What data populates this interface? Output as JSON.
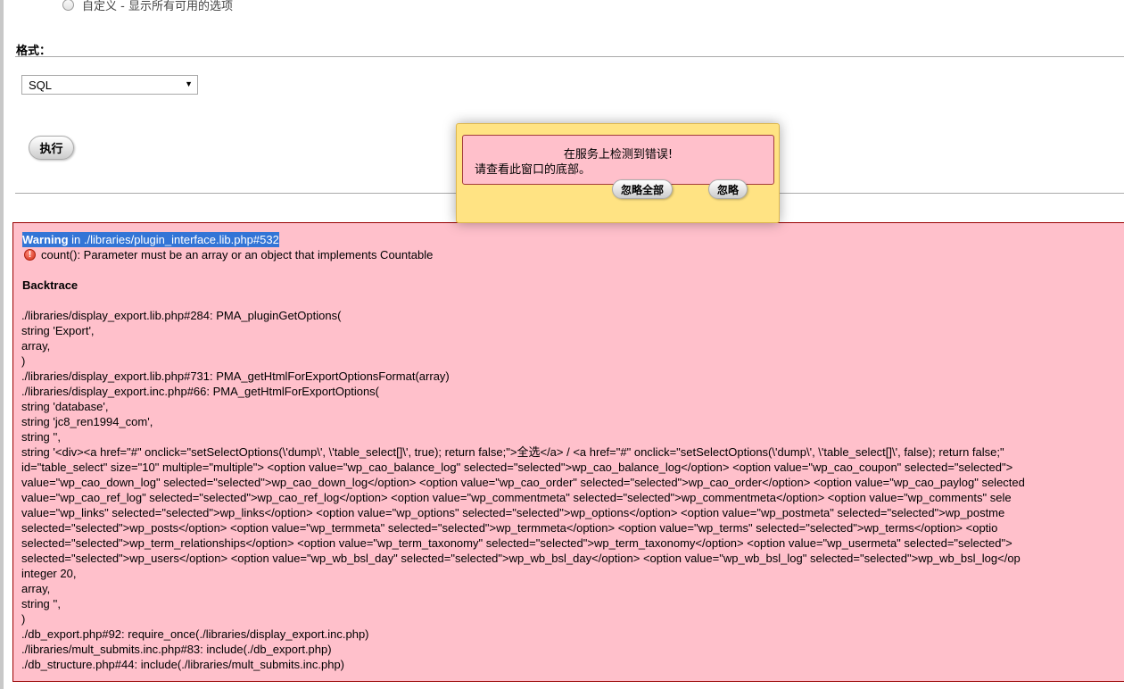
{
  "options": {
    "custom_radio_label": "自定义 - 显示所有可用的选项"
  },
  "format": {
    "label": "格式：",
    "selected": "SQL"
  },
  "execute_label": "执行",
  "error": {
    "warning_word": "Warning",
    "warning_location": " in ./libraries/plugin_interface.lib.php#532",
    "message": "count(): Parameter must be an array or an object that implements Countable",
    "backtrace_title": "Backtrace",
    "backtrace_lines": [
      "./libraries/display_export.lib.php#284: PMA_pluginGetOptions(",
      "string 'Export',",
      "array,",
      ")",
      "./libraries/display_export.lib.php#731: PMA_getHtmlForExportOptionsFormat(array)",
      "./libraries/display_export.inc.php#66: PMA_getHtmlForExportOptions(",
      "string 'database',",
      "string 'jc8_ren1994_com',",
      "string '',",
      "string '<div><a href=\"#\" onclick=\"setSelectOptions(\\'dump\\', \\'table_select[]\\', true); return false;\">全选</a> / <a href=\"#\" onclick=\"setSelectOptions(\\'dump\\', \\'table_select[]\\', false); return false;\"",
      "id=\"table_select\" size=\"10\" multiple=\"multiple\"> <option value=\"wp_cao_balance_log\" selected=\"selected\">wp_cao_balance_log</option> <option value=\"wp_cao_coupon\" selected=\"selected\">",
      "value=\"wp_cao_down_log\" selected=\"selected\">wp_cao_down_log</option> <option value=\"wp_cao_order\" selected=\"selected\">wp_cao_order</option> <option value=\"wp_cao_paylog\" selected",
      "value=\"wp_cao_ref_log\" selected=\"selected\">wp_cao_ref_log</option> <option value=\"wp_commentmeta\" selected=\"selected\">wp_commentmeta</option> <option value=\"wp_comments\" sele",
      "value=\"wp_links\" selected=\"selected\">wp_links</option> <option value=\"wp_options\" selected=\"selected\">wp_options</option> <option value=\"wp_postmeta\" selected=\"selected\">wp_postme",
      "selected=\"selected\">wp_posts</option> <option value=\"wp_termmeta\" selected=\"selected\">wp_termmeta</option> <option value=\"wp_terms\" selected=\"selected\">wp_terms</option> <optio",
      "selected=\"selected\">wp_term_relationships</option> <option value=\"wp_term_taxonomy\" selected=\"selected\">wp_term_taxonomy</option> <option value=\"wp_usermeta\" selected=\"selected\">",
      "selected=\"selected\">wp_users</option> <option value=\"wp_wb_bsl_day\" selected=\"selected\">wp_wb_bsl_day</option> <option value=\"wp_wb_bsl_log\" selected=\"selected\">wp_wb_bsl_log</op",
      "integer 20,",
      "array,",
      "string '',",
      ")",
      "./db_export.php#92: require_once(./libraries/display_export.inc.php)",
      "./libraries/mult_submits.inc.php#83: include(./db_export.php)",
      "./db_structure.php#44: include(./libraries/mult_submits.inc.php)"
    ]
  },
  "modal": {
    "title": "在服务上检测到错误!",
    "subtitle": "请查看此窗口的底部。",
    "ignore_all_label": "忽略全部",
    "ignore_label": "忽略"
  }
}
